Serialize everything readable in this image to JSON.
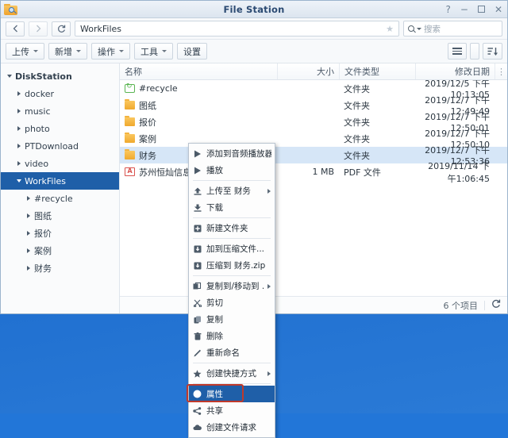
{
  "window": {
    "title": "File Station",
    "app_icon": "folder-search-icon",
    "controls": [
      {
        "name": "help-button",
        "glyph": "?"
      },
      {
        "name": "minimize-button",
        "glyph": "−"
      },
      {
        "name": "maximize-button",
        "glyph": "❐"
      },
      {
        "name": "close-button",
        "glyph": "✕"
      }
    ]
  },
  "address": {
    "back_icon": "chevron-left-icon",
    "forward_icon": "chevron-right-icon",
    "refresh_icon": "refresh-icon",
    "path": "WorkFiles",
    "star_icon": "star-icon",
    "search_placeholder": "搜索"
  },
  "toolbar": {
    "buttons": [
      {
        "label": "上传",
        "caret": true,
        "name": "upload-button"
      },
      {
        "label": "新增",
        "caret": true,
        "name": "new-button"
      },
      {
        "label": "操作",
        "caret": true,
        "name": "action-button"
      },
      {
        "label": "工具",
        "caret": true,
        "name": "tools-button"
      },
      {
        "label": "设置",
        "caret": false,
        "name": "settings-button"
      }
    ]
  },
  "sidebar": {
    "items": [
      {
        "label": "DiskStation",
        "indent": 0,
        "expanded": true,
        "selected": false
      },
      {
        "label": "docker",
        "indent": 1,
        "expanded": false,
        "selected": false
      },
      {
        "label": "music",
        "indent": 1,
        "expanded": false,
        "selected": false
      },
      {
        "label": "photo",
        "indent": 1,
        "expanded": false,
        "selected": false
      },
      {
        "label": "PTDownload",
        "indent": 1,
        "expanded": false,
        "selected": false
      },
      {
        "label": "video",
        "indent": 1,
        "expanded": false,
        "selected": false
      },
      {
        "label": "WorkFiles",
        "indent": 1,
        "expanded": true,
        "selected": true
      },
      {
        "label": "#recycle",
        "indent": 2,
        "expanded": false,
        "selected": false
      },
      {
        "label": "图纸",
        "indent": 2,
        "expanded": false,
        "selected": false
      },
      {
        "label": "报价",
        "indent": 2,
        "expanded": false,
        "selected": false
      },
      {
        "label": "案例",
        "indent": 2,
        "expanded": false,
        "selected": false
      },
      {
        "label": "财务",
        "indent": 2,
        "expanded": false,
        "selected": false
      }
    ]
  },
  "filelist": {
    "columns": {
      "name": "名称",
      "size": "大小",
      "type": "文件类型",
      "date": "修改日期",
      "menu_icon": "column-options-icon"
    },
    "rows": [
      {
        "icon": "recycle-icon",
        "name": "#recycle",
        "size": "",
        "type": "文件夹",
        "date": "2019/12/5 下午10:13:05",
        "selected": false
      },
      {
        "icon": "folder-icon",
        "name": "图纸",
        "size": "",
        "type": "文件夹",
        "date": "2019/12/7 下午12:49:49",
        "selected": false
      },
      {
        "icon": "folder-icon",
        "name": "报价",
        "size": "",
        "type": "文件夹",
        "date": "2019/12/7 下午12:50:01",
        "selected": false
      },
      {
        "icon": "folder-icon",
        "name": "案例",
        "size": "",
        "type": "文件夹",
        "date": "2019/12/7 下午12:50:10",
        "selected": false
      },
      {
        "icon": "folder-icon",
        "name": "财务",
        "size": "",
        "type": "文件夹",
        "date": "2019/12/7 下午12:53:36",
        "selected": true
      },
      {
        "icon": "pdf-icon",
        "name": "苏州恒灿信息技术",
        "size": "1 MB",
        "type": "PDF 文件",
        "date": "2019/11/14 下午1:06:45",
        "selected": false
      }
    ]
  },
  "statusbar": {
    "item_count": "6 个项目",
    "refresh_icon": "refresh-icon"
  },
  "view_controls": {
    "list_icon": "list-view-icon",
    "caret_icon": "chevron-down-icon",
    "sort_icon": "sort-descending-icon"
  },
  "context_menu": {
    "items": [
      {
        "label": "添加到音频播放器",
        "icon": "play-icon",
        "submenu": false,
        "highlighted": false,
        "sep_after": false
      },
      {
        "label": "播放",
        "icon": "play-icon",
        "submenu": false,
        "highlighted": false,
        "sep_after": true
      },
      {
        "label": "上传至 财务",
        "icon": "upload-icon",
        "submenu": true,
        "highlighted": false,
        "sep_after": false
      },
      {
        "label": "下载",
        "icon": "download-icon",
        "submenu": false,
        "highlighted": false,
        "sep_after": true
      },
      {
        "label": "新建文件夹",
        "icon": "new-folder-icon",
        "submenu": false,
        "highlighted": false,
        "sep_after": true
      },
      {
        "label": "加到压缩文件...",
        "icon": "archive-icon",
        "submenu": false,
        "highlighted": false,
        "sep_after": false
      },
      {
        "label": "压缩到 财务.zip",
        "icon": "archive-icon",
        "submenu": false,
        "highlighted": false,
        "sep_after": true
      },
      {
        "label": "复制到/移动到 ...",
        "icon": "copy-move-icon",
        "submenu": true,
        "highlighted": false,
        "sep_after": false
      },
      {
        "label": "剪切",
        "icon": "scissors-icon",
        "submenu": false,
        "highlighted": false,
        "sep_after": false
      },
      {
        "label": "复制",
        "icon": "copy-icon",
        "submenu": false,
        "highlighted": false,
        "sep_after": false
      },
      {
        "label": "删除",
        "icon": "trash-icon",
        "submenu": false,
        "highlighted": false,
        "sep_after": false
      },
      {
        "label": "重新命名",
        "icon": "pencil-icon",
        "submenu": false,
        "highlighted": false,
        "sep_after": true
      },
      {
        "label": "创建快捷方式",
        "icon": "star-icon",
        "submenu": true,
        "highlighted": false,
        "sep_after": true
      },
      {
        "label": "属性",
        "icon": "info-icon",
        "submenu": false,
        "highlighted": true,
        "sep_after": false
      },
      {
        "label": "共享",
        "icon": "share-icon",
        "submenu": false,
        "highlighted": false,
        "sep_after": false
      },
      {
        "label": "创建文件请求",
        "icon": "cloud-upload-icon",
        "submenu": false,
        "highlighted": false,
        "sep_after": false
      }
    ]
  },
  "annotation": {
    "highlight_color": "#c0392b",
    "target": "属性"
  },
  "colors": {
    "accent": "#1f5fa8",
    "selection": "#d6e6f7",
    "desktop": "#2276d8",
    "folder": "#f0a92e"
  }
}
